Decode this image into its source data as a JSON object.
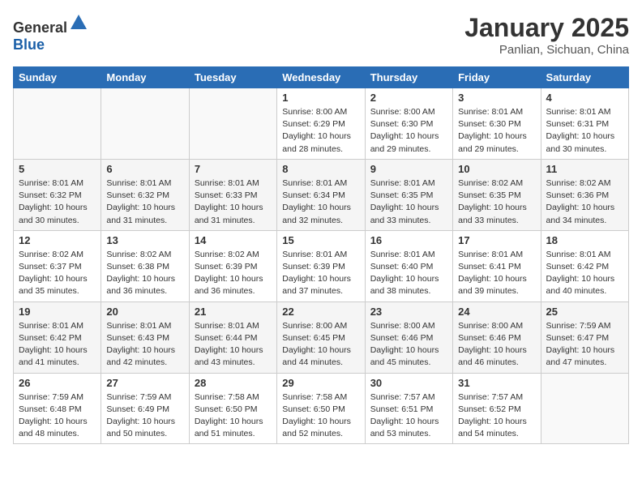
{
  "header": {
    "logo_general": "General",
    "logo_blue": "Blue",
    "month_title": "January 2025",
    "location": "Panlian, Sichuan, China"
  },
  "days_of_week": [
    "Sunday",
    "Monday",
    "Tuesday",
    "Wednesday",
    "Thursday",
    "Friday",
    "Saturday"
  ],
  "weeks": [
    [
      {
        "day": "",
        "info": ""
      },
      {
        "day": "",
        "info": ""
      },
      {
        "day": "",
        "info": ""
      },
      {
        "day": "1",
        "info": "Sunrise: 8:00 AM\nSunset: 6:29 PM\nDaylight: 10 hours\nand 28 minutes."
      },
      {
        "day": "2",
        "info": "Sunrise: 8:00 AM\nSunset: 6:30 PM\nDaylight: 10 hours\nand 29 minutes."
      },
      {
        "day": "3",
        "info": "Sunrise: 8:01 AM\nSunset: 6:30 PM\nDaylight: 10 hours\nand 29 minutes."
      },
      {
        "day": "4",
        "info": "Sunrise: 8:01 AM\nSunset: 6:31 PM\nDaylight: 10 hours\nand 30 minutes."
      }
    ],
    [
      {
        "day": "5",
        "info": "Sunrise: 8:01 AM\nSunset: 6:32 PM\nDaylight: 10 hours\nand 30 minutes."
      },
      {
        "day": "6",
        "info": "Sunrise: 8:01 AM\nSunset: 6:32 PM\nDaylight: 10 hours\nand 31 minutes."
      },
      {
        "day": "7",
        "info": "Sunrise: 8:01 AM\nSunset: 6:33 PM\nDaylight: 10 hours\nand 31 minutes."
      },
      {
        "day": "8",
        "info": "Sunrise: 8:01 AM\nSunset: 6:34 PM\nDaylight: 10 hours\nand 32 minutes."
      },
      {
        "day": "9",
        "info": "Sunrise: 8:01 AM\nSunset: 6:35 PM\nDaylight: 10 hours\nand 33 minutes."
      },
      {
        "day": "10",
        "info": "Sunrise: 8:02 AM\nSunset: 6:35 PM\nDaylight: 10 hours\nand 33 minutes."
      },
      {
        "day": "11",
        "info": "Sunrise: 8:02 AM\nSunset: 6:36 PM\nDaylight: 10 hours\nand 34 minutes."
      }
    ],
    [
      {
        "day": "12",
        "info": "Sunrise: 8:02 AM\nSunset: 6:37 PM\nDaylight: 10 hours\nand 35 minutes."
      },
      {
        "day": "13",
        "info": "Sunrise: 8:02 AM\nSunset: 6:38 PM\nDaylight: 10 hours\nand 36 minutes."
      },
      {
        "day": "14",
        "info": "Sunrise: 8:02 AM\nSunset: 6:39 PM\nDaylight: 10 hours\nand 36 minutes."
      },
      {
        "day": "15",
        "info": "Sunrise: 8:01 AM\nSunset: 6:39 PM\nDaylight: 10 hours\nand 37 minutes."
      },
      {
        "day": "16",
        "info": "Sunrise: 8:01 AM\nSunset: 6:40 PM\nDaylight: 10 hours\nand 38 minutes."
      },
      {
        "day": "17",
        "info": "Sunrise: 8:01 AM\nSunset: 6:41 PM\nDaylight: 10 hours\nand 39 minutes."
      },
      {
        "day": "18",
        "info": "Sunrise: 8:01 AM\nSunset: 6:42 PM\nDaylight: 10 hours\nand 40 minutes."
      }
    ],
    [
      {
        "day": "19",
        "info": "Sunrise: 8:01 AM\nSunset: 6:42 PM\nDaylight: 10 hours\nand 41 minutes."
      },
      {
        "day": "20",
        "info": "Sunrise: 8:01 AM\nSunset: 6:43 PM\nDaylight: 10 hours\nand 42 minutes."
      },
      {
        "day": "21",
        "info": "Sunrise: 8:01 AM\nSunset: 6:44 PM\nDaylight: 10 hours\nand 43 minutes."
      },
      {
        "day": "22",
        "info": "Sunrise: 8:00 AM\nSunset: 6:45 PM\nDaylight: 10 hours\nand 44 minutes."
      },
      {
        "day": "23",
        "info": "Sunrise: 8:00 AM\nSunset: 6:46 PM\nDaylight: 10 hours\nand 45 minutes."
      },
      {
        "day": "24",
        "info": "Sunrise: 8:00 AM\nSunset: 6:46 PM\nDaylight: 10 hours\nand 46 minutes."
      },
      {
        "day": "25",
        "info": "Sunrise: 7:59 AM\nSunset: 6:47 PM\nDaylight: 10 hours\nand 47 minutes."
      }
    ],
    [
      {
        "day": "26",
        "info": "Sunrise: 7:59 AM\nSunset: 6:48 PM\nDaylight: 10 hours\nand 48 minutes."
      },
      {
        "day": "27",
        "info": "Sunrise: 7:59 AM\nSunset: 6:49 PM\nDaylight: 10 hours\nand 50 minutes."
      },
      {
        "day": "28",
        "info": "Sunrise: 7:58 AM\nSunset: 6:50 PM\nDaylight: 10 hours\nand 51 minutes."
      },
      {
        "day": "29",
        "info": "Sunrise: 7:58 AM\nSunset: 6:50 PM\nDaylight: 10 hours\nand 52 minutes."
      },
      {
        "day": "30",
        "info": "Sunrise: 7:57 AM\nSunset: 6:51 PM\nDaylight: 10 hours\nand 53 minutes."
      },
      {
        "day": "31",
        "info": "Sunrise: 7:57 AM\nSunset: 6:52 PM\nDaylight: 10 hours\nand 54 minutes."
      },
      {
        "day": "",
        "info": ""
      }
    ]
  ]
}
